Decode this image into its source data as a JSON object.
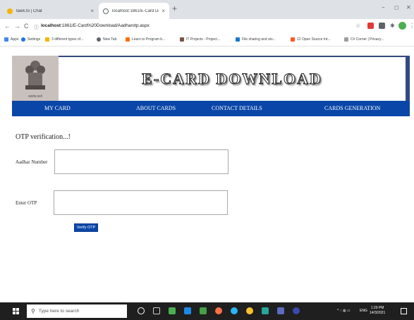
{
  "browser": {
    "tabs": [
      {
        "title": "tawk.to | Chat",
        "active": false
      },
      {
        "title": "localhost:1861/E-Card Download",
        "active": true
      }
    ],
    "new_tab_label": "+",
    "close_label": "×",
    "window_controls": [
      "−",
      "◻",
      "✕"
    ],
    "nav": {
      "back": "←",
      "forward": "→",
      "reload": "C",
      "info": "ⓘ"
    },
    "url": {
      "host": "localhost",
      "rest": ":1861/E-Card%20Download/Aadharotp.aspx"
    },
    "bookmarks": [
      {
        "label": "Apps",
        "color": "#4285f4"
      },
      {
        "label": "Settings",
        "color": "#1a73e8"
      },
      {
        "label": "3 different types of...",
        "color": "#f4b400"
      },
      {
        "label": "New Tab",
        "color": "#5f6368"
      },
      {
        "label": "Learn to Program b...",
        "color": "#ff6d00"
      },
      {
        "label": "IT Projects - Project...",
        "color": "#795548"
      },
      {
        "label": "File sharing and sto...",
        "color": "#1976d2"
      },
      {
        "label": "12 Open Source Int...",
        "color": "#ff5722"
      },
      {
        "label": "C# Corner | Privacy...",
        "color": "#9e9e9e"
      }
    ]
  },
  "page": {
    "banner_title": "E-CARD DOWNLOAD",
    "emblem_caption": "सत्यमेव जयते",
    "nav": [
      "MY CARD",
      "ABOUT CARDS",
      "CONTACT DETAILS",
      "CARDS GENERATION"
    ],
    "form": {
      "title": "OTP verification...!",
      "aadhar_label": "Aadhar Number",
      "aadhar_value": "",
      "otp_label": "Enter OTP",
      "otp_value": "",
      "verify_label": "Verify OTP"
    }
  },
  "taskbar": {
    "search_placeholder": "Type here to search",
    "tray_text": "ENG",
    "time": "1:29 PM",
    "date": "14/3/2021"
  },
  "colors": {
    "navbar": "#0a46a8",
    "banner_border": "#324a82",
    "taskbar": "#1f1f1f"
  }
}
